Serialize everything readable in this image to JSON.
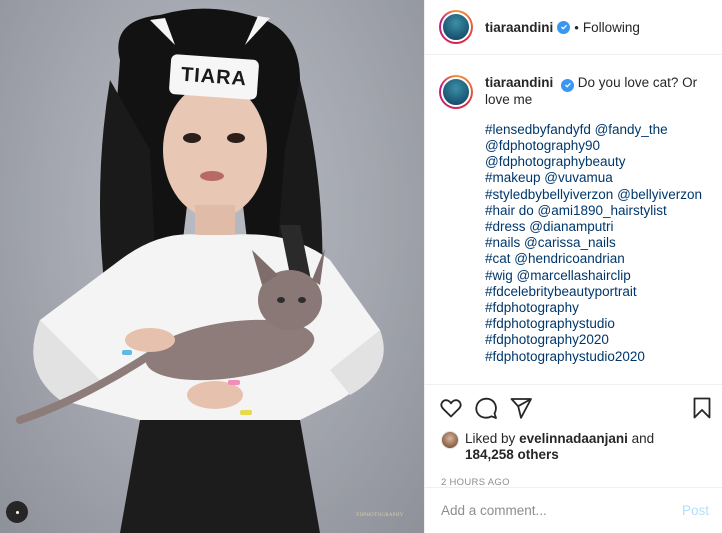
{
  "post": {
    "author": "tiaraandini",
    "follow_state": "Following",
    "separator": "•",
    "verified_icon": "verified-badge-icon",
    "accent_color": "#3897f0"
  },
  "photo": {
    "headband_text": "TIARA",
    "watermark_text": "FDPHOTOGRAPHY"
  },
  "caption": {
    "author": "tiaraandini",
    "text": "Do you love cat? Or love me",
    "tags": [
      "#lensedbyfandyfd @fandy_the",
      "@fdphotography90",
      "@fdphotographybeauty",
      "#makeup @vuvamua",
      "#styledbybellyiverzon @bellyiverzon",
      "#hair do @ami1890_hairstylist",
      "#dress @dianamputri",
      "#nails @carissa_nails",
      "#cat @hendricoandrian",
      "#wig @marcellashairclip",
      "#fdcelebritybeautyportrait",
      "#fdphotography",
      "#fdphotographystudio",
      "#fdphotography2020",
      "#fdphotographystudio2020"
    ]
  },
  "actions": {
    "like_icon": "heart-icon",
    "comment_icon": "comment-icon",
    "share_icon": "share-icon",
    "save_icon": "bookmark-icon"
  },
  "likes": {
    "prefix": "Liked by",
    "liker": "evelinnadaanjani",
    "and": "and",
    "count_text": "184,258 others"
  },
  "timestamp": "2 HOURS AGO",
  "comment": {
    "placeholder": "Add a comment...",
    "post_label": "Post"
  }
}
